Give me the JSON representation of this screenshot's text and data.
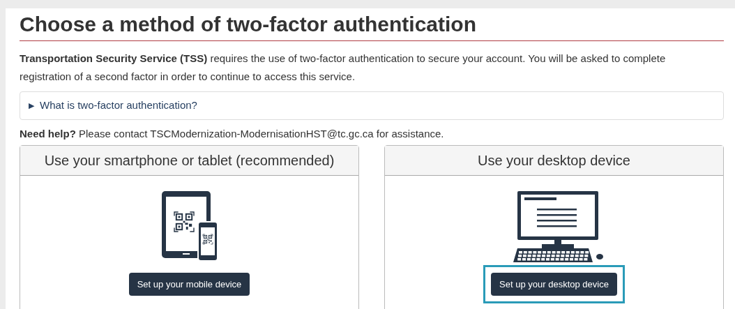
{
  "title": "Choose a method of two-factor authentication",
  "intro": "**Transportation Security Service (TSS)** requires the use of two-factor authentication to secure your account. You will be asked to complete registration of a second factor in order to continue to access this service.",
  "details": {
    "marker": "▶",
    "summary": "What is two-factor authentication?",
    "expanded": false
  },
  "help": "**Need help?** Please contact TSCModernization-ModernisationHST@tc.gc.ca for assistance.",
  "options": [
    {
      "kind": "mobile",
      "heading": "Use your smartphone or tablet (recommended)",
      "button": "Set up your mobile device",
      "highlighted": false
    },
    {
      "kind": "desktop",
      "heading": "Use your desktop device",
      "button": "Set up your desktop device",
      "highlighted": true
    }
  ]
}
